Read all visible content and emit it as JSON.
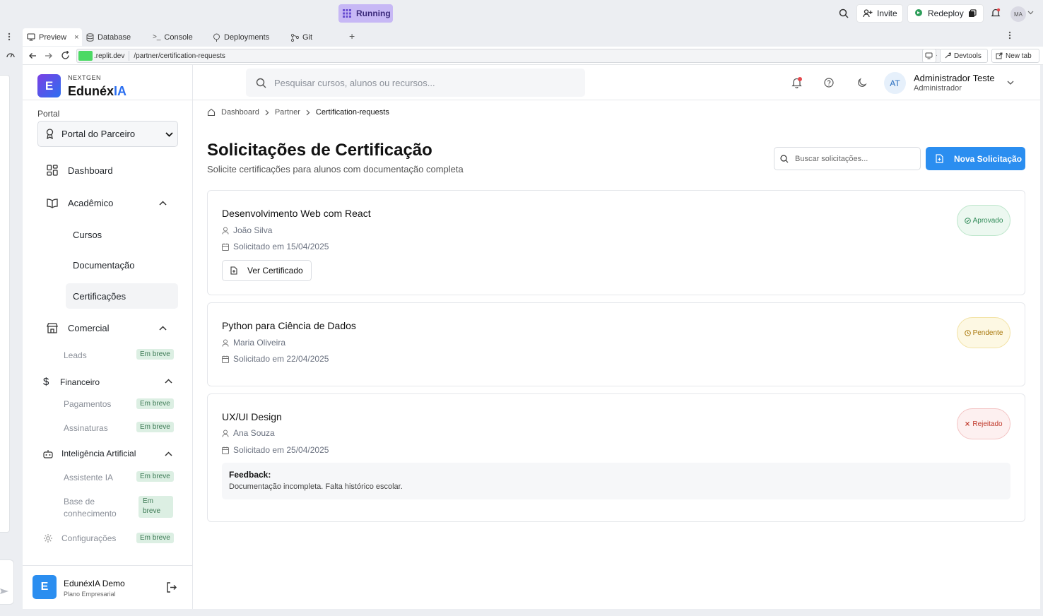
{
  "replit": {
    "running_label": "Running",
    "invite_label": "Invite",
    "redeploy_label": "Redeploy",
    "avatar_initials": "MA"
  },
  "tabs": [
    {
      "label": "Preview"
    },
    {
      "label": "Database"
    },
    {
      "label": "Console"
    },
    {
      "label": "Deployments"
    },
    {
      "label": "Git"
    }
  ],
  "browser": {
    "domain": ".replit.dev",
    "path": "/partner/certification-requests",
    "devtools_label": "Devtools",
    "newtab_label": "New tab"
  },
  "brand": {
    "logo_letter": "E",
    "tagline": "NEXTGEN",
    "name_part1": "Edunéx",
    "name_part2": "IA"
  },
  "sidebar": {
    "portal_label": "Portal",
    "portal_select": "Portal do Parceiro",
    "dashboard": "Dashboard",
    "academico": "Acadêmico",
    "cursos": "Cursos",
    "documentacao": "Documentação",
    "certificacoes": "Certificações",
    "comercial": "Comercial",
    "leads": "Leads",
    "financeiro": "Financeiro",
    "pagamentos": "Pagamentos",
    "assinaturas": "Assinaturas",
    "ia": "Inteligência Artificial",
    "assistente": "Assistente IA",
    "base_line1": "Base de",
    "base_line2": "conhecimento",
    "configuracoes": "Configurações",
    "soon": "Em breve",
    "soon_line1": "Em",
    "soon_line2": "breve",
    "footer_letter": "E",
    "footer_name": "EdunéxIA Demo",
    "footer_plan": "Plano Empresarial"
  },
  "header": {
    "search_placeholder": "Pesquisar cursos, alunos ou recursos...",
    "avatar_initials": "AT",
    "user_name": "Administrador Teste",
    "user_role": "Administrador"
  },
  "breadcrumb": [
    "Dashboard",
    "Partner",
    "Certification-requests"
  ],
  "page": {
    "title": "Solicitações de Certificação",
    "subtitle": "Solicite certificações para alunos com documentação completa",
    "search_placeholder": "Buscar solicitações...",
    "new_button": "Nova Solicitação"
  },
  "requests": [
    {
      "course": "Desenvolvimento Web com React",
      "student": "João Silva",
      "date": "Solicitado em 15/04/2025",
      "status": "Aprovado",
      "action": "Ver Certificado"
    },
    {
      "course": "Python para Ciência de Dados",
      "student": "Maria Oliveira",
      "date": "Solicitado em 22/04/2025",
      "status": "Pendente"
    },
    {
      "course": "UX/UI Design",
      "student": "Ana Souza",
      "date": "Solicitado em 25/04/2025",
      "status": "Rejeitado",
      "feedback_label": "Feedback:",
      "feedback_text": "Documentação incompleta. Falta histórico escolar."
    }
  ],
  "colors": {
    "primary": "#2b8ef0",
    "approved": "#2f8a57",
    "pending": "#a8770b",
    "rejected": "#c0392b",
    "brand_accent": "#2b6ff0"
  }
}
